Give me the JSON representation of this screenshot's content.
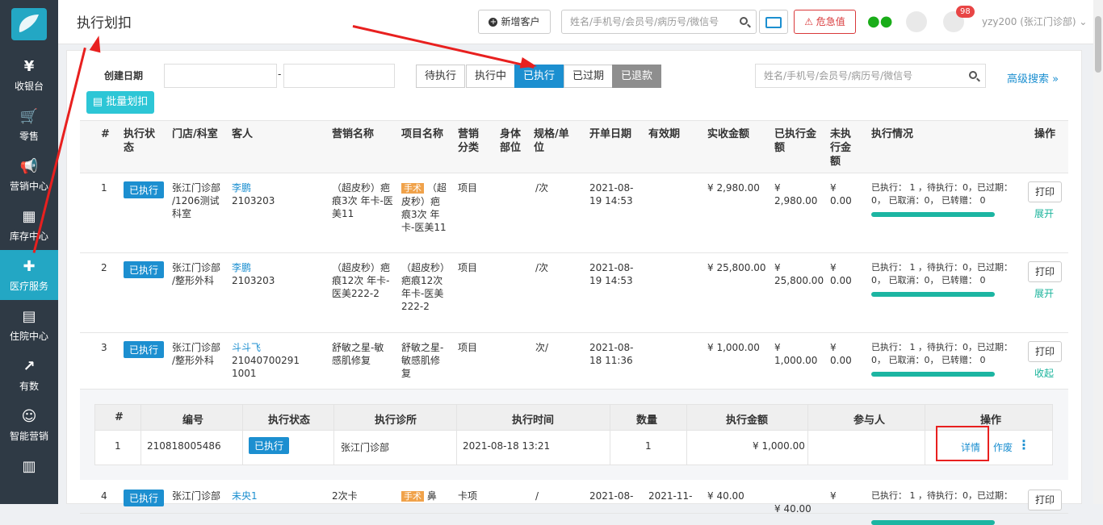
{
  "sidebar": {
    "items": [
      {
        "icon": "¥",
        "icon_name": "yen-icon",
        "label": "收银台"
      },
      {
        "icon": "🛒",
        "icon_name": "cart-icon",
        "label": "零售"
      },
      {
        "icon": "📢",
        "icon_name": "megaphone-icon",
        "label": "营销中心"
      },
      {
        "icon": "▦",
        "icon_name": "grid-icon",
        "label": "库存中心"
      },
      {
        "icon": "✚",
        "icon_name": "medkit-icon",
        "label": "医疗服务",
        "active": true
      },
      {
        "icon": "▤",
        "icon_name": "building-icon",
        "label": "住院中心"
      },
      {
        "icon": "↗",
        "icon_name": "trend-icon",
        "label": "有数"
      },
      {
        "icon": "☺",
        "icon_name": "robot-icon",
        "label": "智能营销"
      },
      {
        "icon": "▥",
        "icon_name": "bar-chart-icon",
        "label": ""
      }
    ]
  },
  "topbar": {
    "title": "执行划扣",
    "new_customer": "新增客户",
    "search_placeholder": "姓名/手机号/会员号/病历号/微信号",
    "danger_label": "危急值",
    "notification_count": "98",
    "user": "yzy200 (张江门诊部)"
  },
  "filters": {
    "date_label": "创建日期",
    "date_sep": "-",
    "status_tabs": [
      "待执行",
      "执行中",
      "已执行",
      "已过期",
      "已退款"
    ],
    "active_tab": "已执行",
    "search_placeholder": "姓名/手机号/会员号/病历号/微信号",
    "advanced": "高级搜索",
    "batch_button": "批量划扣"
  },
  "table": {
    "headers": {
      "num": "#",
      "status": "执行状态",
      "store": "门店/科室",
      "customer": "客人",
      "marketing": "营销名称",
      "project": "项目名称",
      "category": "营销分类",
      "body": "身体部位",
      "spec": "规格/单位",
      "order_date": "开单日期",
      "validity": "有效期",
      "paid": "实收金额",
      "executed": "已执行金额",
      "unexecuted": "未执行金额",
      "exec_info": "执行情况",
      "ops": "操作"
    },
    "rows": [
      {
        "num": "1",
        "status": "已执行",
        "store": "张江门诊部 /1206测试科室",
        "customer_name": "李鹏",
        "customer_id": "2103203",
        "marketing": "（超皮秒）疤痕3次 年卡-医美11",
        "project_tag": "手术",
        "project": "（超皮秒）疤痕3次 年卡-医美11",
        "category": "项目",
        "spec": "/次",
        "order_date": "2021-08-19 14:53",
        "validity": "",
        "paid": "¥ 2,980.00",
        "executed_cur": "¥",
        "executed": "2,980.00",
        "unexecuted_cur": "¥",
        "unexecuted": "0.00",
        "exec_info": "已执行： 1 ，待执行：0，已过期：0， 已取消：0， 已转赠： 0",
        "progress": 1.0,
        "print": "打印",
        "toggle": "展开"
      },
      {
        "num": "2",
        "status": "已执行",
        "store": "张江门诊部 /整形外科",
        "customer_name": "李鹏",
        "customer_id": "2103203",
        "marketing": "（超皮秒）疤痕12次 年卡-医美222-2",
        "project_tag": "",
        "project": "（超皮秒）疤痕12次 年卡-医美222-2",
        "category": "项目",
        "spec": "/次",
        "order_date": "2021-08-19 14:53",
        "validity": "",
        "paid": "¥ 25,800.00",
        "executed_cur": "¥",
        "executed": "25,800.00",
        "unexecuted_cur": "¥",
        "unexecuted": "0.00",
        "exec_info": "已执行： 1 ，待执行：0，已过期：0， 已取消：0， 已转赠： 0",
        "progress": 1.0,
        "print": "打印",
        "toggle": "展开"
      },
      {
        "num": "3",
        "status": "已执行",
        "store": "张江门诊部 /整形外科",
        "customer_name": "斗斗飞",
        "customer_id": "210407002911001",
        "marketing": "舒敏之星-敏感肌修复",
        "project_tag": "",
        "project": "舒敏之星-敏感肌修复",
        "category": "项目",
        "spec": "次/",
        "order_date": "2021-08-18 11:36",
        "validity": "",
        "paid": "¥ 1,000.00",
        "executed_cur": "¥",
        "executed": "1,000.00",
        "unexecuted_cur": "¥",
        "unexecuted": "0.00",
        "exec_info": "已执行： 1 ，待执行：0，已过期：0， 已取消：0， 已转赠： 0",
        "progress": 1.0,
        "print": "打印",
        "toggle": "收起"
      },
      {
        "num": "4",
        "status": "已执行",
        "store": "张江门诊部",
        "customer_name": "未央1",
        "customer_id": "",
        "marketing": "2次卡",
        "project_tag": "手术",
        "project": "鼻",
        "category": "卡项",
        "spec": "/",
        "order_date": "2021-08-",
        "validity": "2021-11-",
        "paid": "¥ 40.00",
        "executed_cur": "",
        "executed": "¥ 40.00",
        "unexecuted_cur": "¥",
        "unexecuted": "",
        "exec_info": "已执行： 1 ，待执行：0，已过期：",
        "progress": 1.0,
        "print": "打印",
        "toggle": ""
      }
    ]
  },
  "subtable": {
    "headers": [
      "#",
      "编号",
      "执行状态",
      "执行诊所",
      "执行时间",
      "数量",
      "执行金额",
      "参与人",
      "操作"
    ],
    "row": {
      "num": "1",
      "code": "210818005486",
      "status": "已执行",
      "clinic": "张江门诊部",
      "time": "2021-08-18 13:21",
      "qty": "1",
      "amount": "¥ 1,000.00",
      "participants": "",
      "detail": "详情",
      "void": "作废",
      "more": "⋮"
    }
  },
  "colors": {
    "accent": "#1c8fd0",
    "sidebar": "#2f3a45",
    "active_nav": "#23a7c4",
    "annotation": "#e8201f",
    "progress": "#1cb5a2"
  }
}
